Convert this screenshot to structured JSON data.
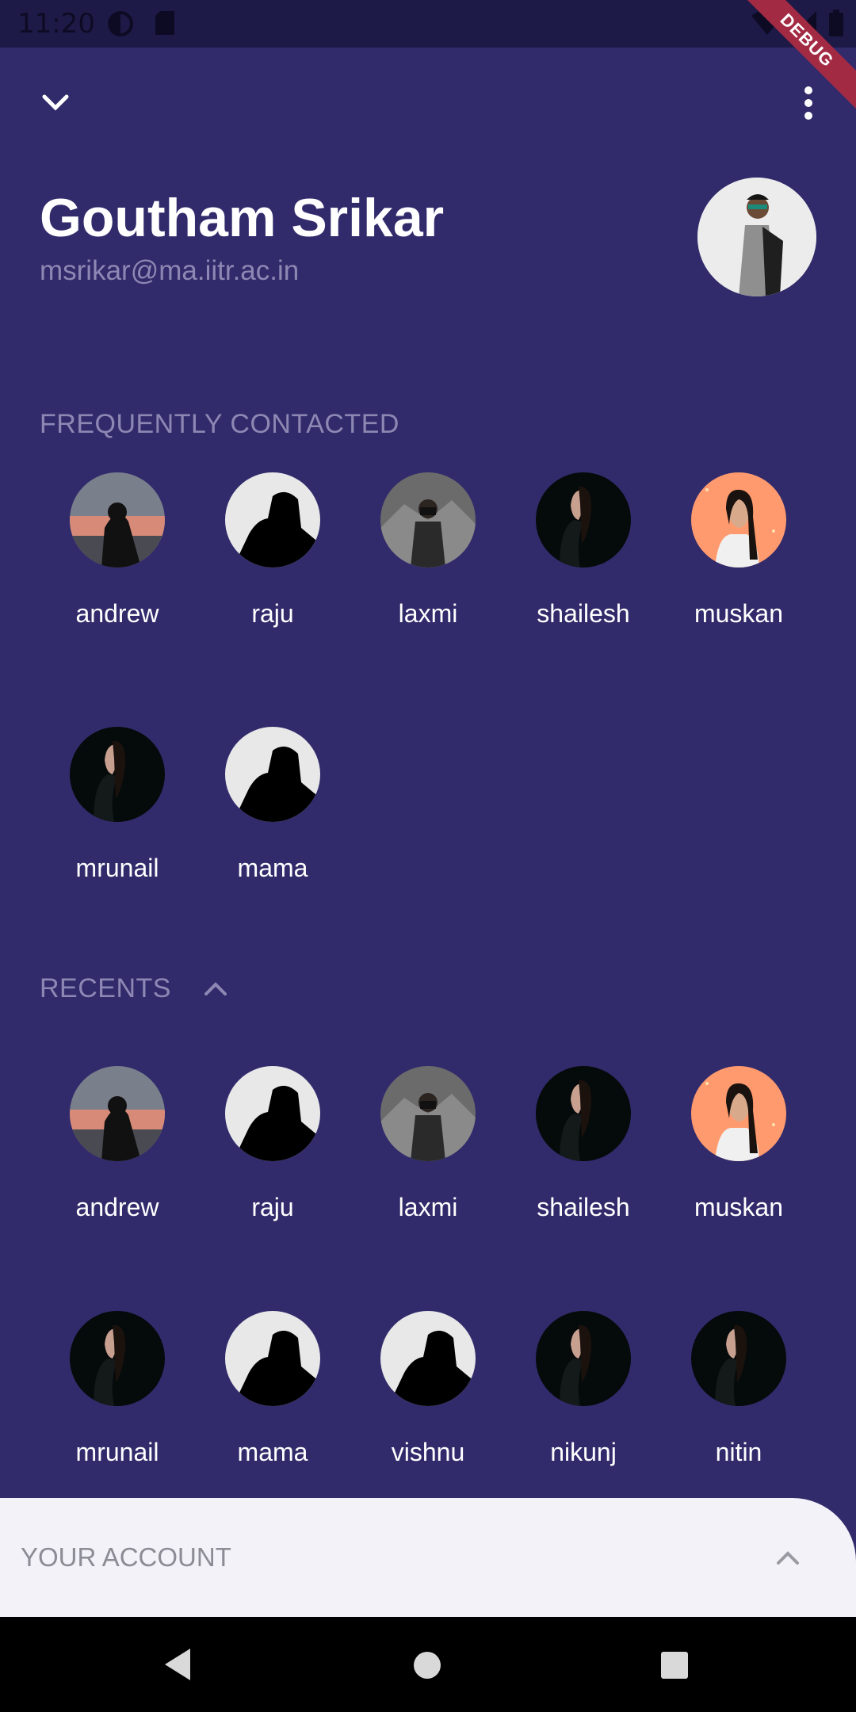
{
  "status_bar": {
    "time": "11:20",
    "debug_label": "DEBUG"
  },
  "top_bar": {
    "collapse_icon": "chevron-down-icon",
    "menu_icon": "more-vert-icon"
  },
  "profile": {
    "name": "Goutham Srikar",
    "email": "msrikar@ma.iitr.ac.in"
  },
  "frequent": {
    "title": "FREQUENTLY CONTACTED",
    "contacts": [
      {
        "name": "andrew",
        "avatar": "sunset-silhouette"
      },
      {
        "name": "raju",
        "avatar": "dark-silhouette"
      },
      {
        "name": "laxmi",
        "avatar": "photographer"
      },
      {
        "name": "shailesh",
        "avatar": "woman-dark"
      },
      {
        "name": "muskan",
        "avatar": "woman-orange"
      },
      {
        "name": "mrunail",
        "avatar": "woman-dark"
      },
      {
        "name": "mama",
        "avatar": "dark-silhouette"
      }
    ]
  },
  "recents": {
    "title": "RECENTS",
    "toggle_icon": "chevron-up-icon",
    "contacts": [
      {
        "name": "andrew",
        "avatar": "sunset-silhouette"
      },
      {
        "name": "raju",
        "avatar": "dark-silhouette"
      },
      {
        "name": "laxmi",
        "avatar": "photographer"
      },
      {
        "name": "shailesh",
        "avatar": "woman-dark"
      },
      {
        "name": "muskan",
        "avatar": "woman-orange"
      },
      {
        "name": "mrunail",
        "avatar": "woman-dark"
      },
      {
        "name": "mama",
        "avatar": "dark-silhouette"
      },
      {
        "name": "vishnu",
        "avatar": "dark-silhouette"
      },
      {
        "name": "nikunj",
        "avatar": "woman-dark"
      },
      {
        "name": "nitin",
        "avatar": "woman-dark"
      }
    ]
  },
  "account_sheet": {
    "title": "YOUR ACCOUNT",
    "toggle_icon": "chevron-up-icon"
  },
  "nav": {
    "back_icon": "back-triangle-icon",
    "home_icon": "home-circle-icon",
    "recents_icon": "recents-square-icon"
  },
  "colors": {
    "background": "#312B6B",
    "muted_text": "#8D88B3",
    "sheet": "#F3F2F8",
    "debug": "#A32A43"
  }
}
